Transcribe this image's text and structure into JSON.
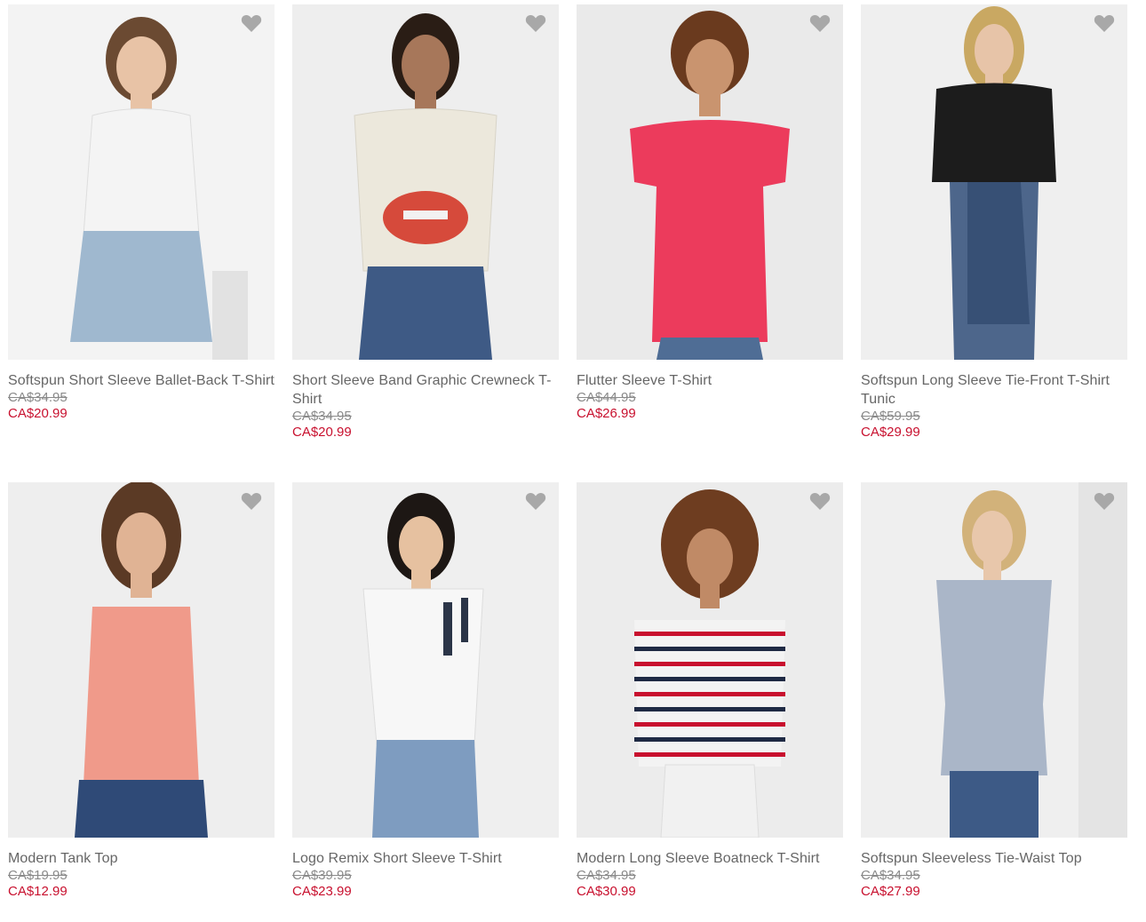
{
  "colors": {
    "sale_price": "#c8102e",
    "strike_price": "#8a8a8a",
    "product_name": "#666666",
    "favorite_icon": "#a8a8a8"
  },
  "products": [
    {
      "name": "Softspun Short Sleeve Ballet-Back T-Shirt",
      "original_price": "CA$34.95",
      "sale_price": "CA$20.99",
      "favorite_icon": "heart-icon",
      "shirt_color": "#f4f4f4",
      "bottom_color": "#9fb8cf",
      "hair_color": "#6b4a32"
    },
    {
      "name": "Short Sleeve Band Graphic Crewneck T-Shirt",
      "original_price": "CA$34.95",
      "sale_price": "CA$20.99",
      "favorite_icon": "heart-icon",
      "shirt_color": "#ece8dc",
      "bottom_color": "#3e5a85",
      "hair_color": "#2a1d15"
    },
    {
      "name": "Flutter Sleeve T-Shirt",
      "original_price": "CA$44.95",
      "sale_price": "CA$26.99",
      "favorite_icon": "heart-icon",
      "shirt_color": "#ec3b5c",
      "bottom_color": "#4f6d95",
      "hair_color": "#6a3a1e"
    },
    {
      "name": "Softspun Long Sleeve Tie-Front T-Shirt Tunic",
      "original_price": "CA$59.95",
      "sale_price": "CA$29.99",
      "favorite_icon": "heart-icon",
      "shirt_color": "#1c1c1c",
      "bottom_color": "#3b567f",
      "hair_color": "#c9a862"
    },
    {
      "name": "Modern Tank Top",
      "original_price": "CA$19.95",
      "sale_price": "CA$12.99",
      "favorite_icon": "heart-icon",
      "shirt_color": "#f09a8a",
      "bottom_color": "#2f4a77",
      "hair_color": "#5b3a25"
    },
    {
      "name": "Logo Remix Short Sleeve T-Shirt",
      "original_price": "CA$39.95",
      "sale_price": "CA$23.99",
      "favorite_icon": "heart-icon",
      "shirt_color": "#f7f7f7",
      "bottom_color": "#7e9cc0",
      "hair_color": "#1d1714"
    },
    {
      "name": "Modern Long Sleeve Boatneck T-Shirt",
      "original_price": "CA$34.95",
      "sale_price": "CA$30.99",
      "favorite_icon": "heart-icon",
      "shirt_color": "#f3f3f3",
      "bottom_color": "#f1f1f1",
      "hair_color": "#6e3d20"
    },
    {
      "name": "Softspun Sleeveless Tie-Waist Top",
      "original_price": "CA$34.95",
      "sale_price": "CA$27.99",
      "favorite_icon": "heart-icon",
      "shirt_color": "#aab6c8",
      "bottom_color": "#3d5a86",
      "hair_color": "#d2b27a"
    }
  ]
}
